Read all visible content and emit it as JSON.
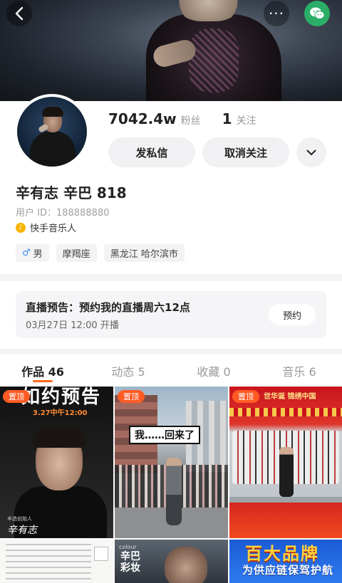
{
  "header": {
    "back_icon": "chevron-left-icon",
    "more_label": "···",
    "share_icon": "wechat-icon"
  },
  "profile": {
    "fans_count": "7042.4w",
    "fans_label": "粉丝",
    "following_count": "1",
    "following_label": "关注",
    "message_button": "发私信",
    "unfollow_button": "取消关注",
    "name": "辛有志 辛巴 818",
    "user_id": "用户 ID：188888880",
    "verification": "快手音乐人",
    "tags": [
      "男",
      "摩羯座",
      "黑龙江 哈尔滨市"
    ]
  },
  "live_notice": {
    "title": "直播预告：预约我的直播周六12点",
    "time": "03月27日 12:00 开播",
    "button": "预约"
  },
  "tabs": [
    {
      "label": "作品 46",
      "active": true
    },
    {
      "label": "动态 5",
      "active": false
    },
    {
      "label": "收藏 0",
      "active": false
    },
    {
      "label": "音乐 6",
      "active": false
    }
  ],
  "grid": {
    "pin_label": "置顶",
    "cell1": {
      "headline": "如约预告",
      "date": "3.27中午12:00",
      "sub": "辛选创始人",
      "signature": "辛有志"
    },
    "cell2": {
      "caption": "我……回来了"
    },
    "cell3": {
      "banner": "世华诞  锦绣中国"
    },
    "cell5": {
      "small": "colour",
      "big": "辛巴\n彩妆"
    },
    "cell6": {
      "line1": "百大品牌",
      "line2": "为供应链保驾护航"
    }
  },
  "colors": {
    "accent": "#ff6a1a",
    "pin": "#ff5a24",
    "wechat": "#2aae67",
    "verify": "#f6b400",
    "male": "#3d8ff2"
  }
}
